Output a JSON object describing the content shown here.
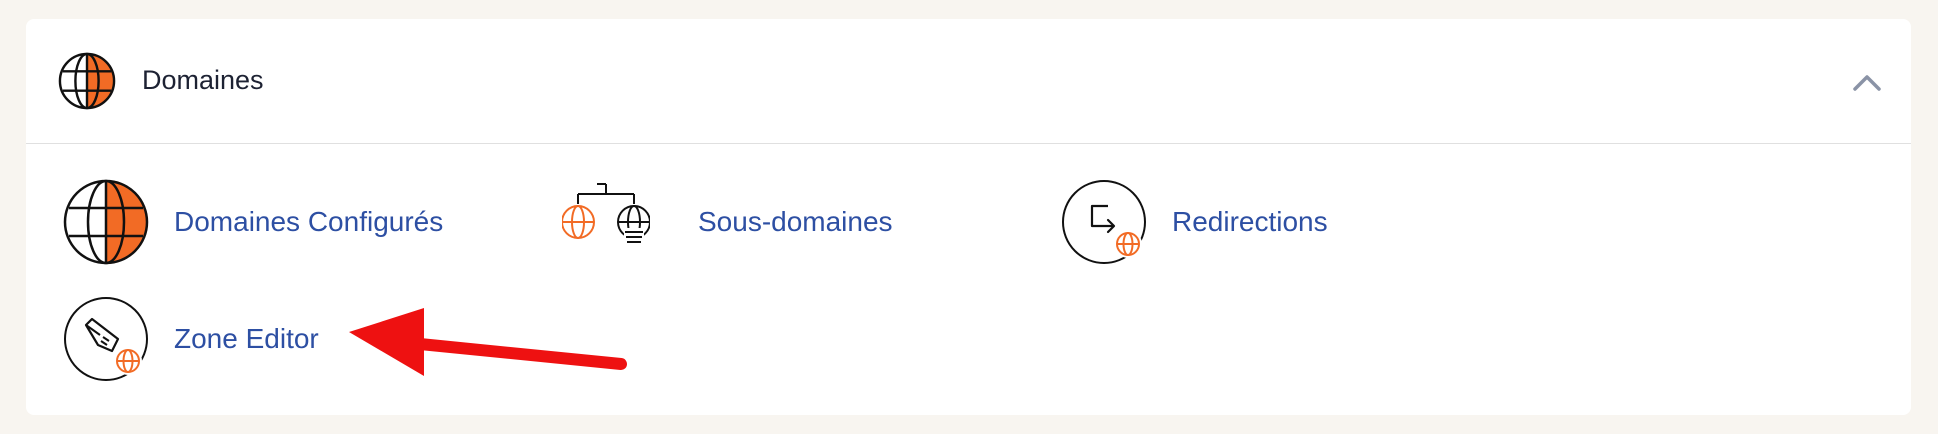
{
  "section": {
    "title": "Domaines",
    "collapse_icon": "chevron-up-icon",
    "accent_color": "#f26b25",
    "link_color": "#2d4fa3"
  },
  "tools": [
    {
      "label": "Domaines Configurés",
      "icon": "globe-icon"
    },
    {
      "label": "Sous-domaines",
      "icon": "subdomains-icon"
    },
    {
      "label": "Redirections",
      "icon": "redirect-icon"
    },
    {
      "label": "Zone Editor",
      "icon": "zone-editor-icon"
    }
  ],
  "annotation": {
    "icon": "red-arrow-icon",
    "color": "#ee1111"
  }
}
